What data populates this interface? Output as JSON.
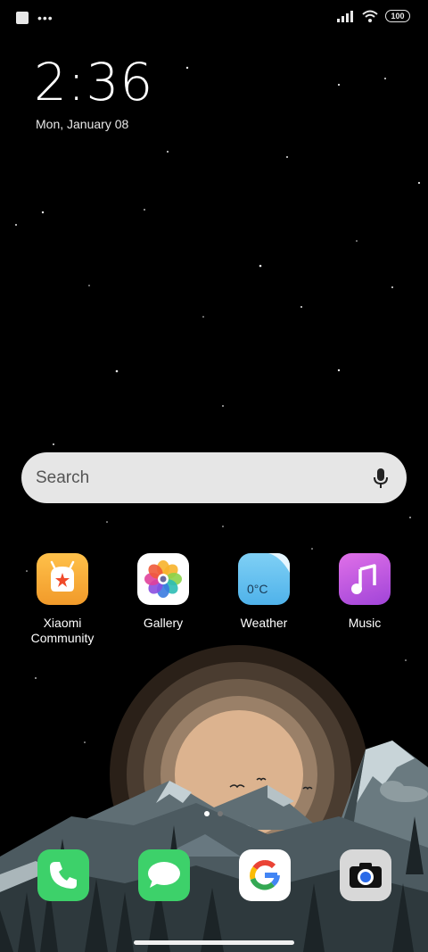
{
  "status": {
    "battery": "100"
  },
  "lockscreen": {
    "time": "2:36",
    "date": "Mon, January 08"
  },
  "search": {
    "placeholder": "Search"
  },
  "apps": [
    {
      "label": "Xiaomi Community",
      "icon": "xiaomi-community-icon"
    },
    {
      "label": "Gallery",
      "icon": "gallery-icon"
    },
    {
      "label": "Weather",
      "icon": "weather-icon",
      "badge": "0°C"
    },
    {
      "label": "Music",
      "icon": "music-icon"
    }
  ],
  "dock": [
    {
      "icon": "phone-icon"
    },
    {
      "icon": "messages-icon"
    },
    {
      "icon": "google-icon",
      "glyph": "G"
    },
    {
      "icon": "camera-icon"
    }
  ],
  "colors": {
    "search_bg": "#e6e6e6",
    "sun": "#dcb38f",
    "mountain": "#4c5a60"
  }
}
